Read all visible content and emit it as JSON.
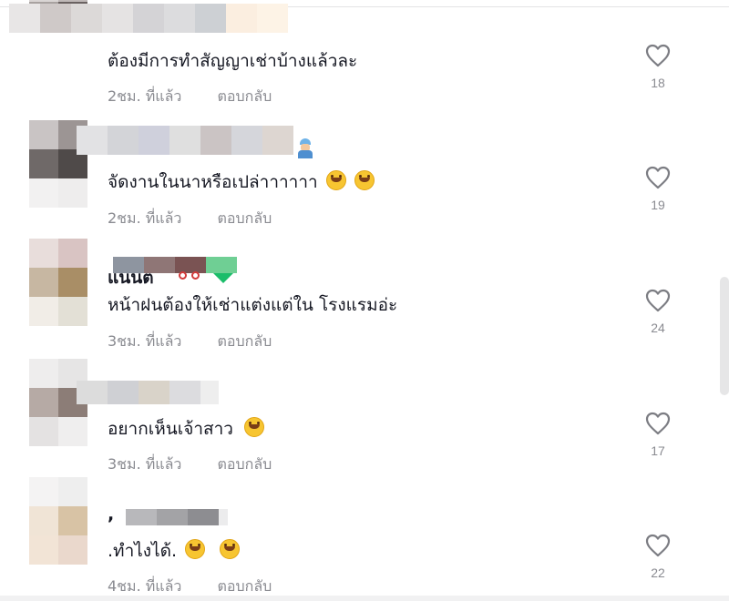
{
  "comments": [
    {
      "text": "ต้องมีการทำสัญญาเช่าบ้างแล้วละ",
      "time": "2ชม. ที่แล้ว",
      "reply": "ตอบกลับ",
      "likes": "18",
      "emojis": []
    },
    {
      "text": "จัดงานในนาหรือเปล่าาาาาา",
      "time": "2ชม. ที่แล้ว",
      "reply": "ตอบกลับ",
      "likes": "19",
      "emojis": [
        "grinning-sweat-emoji",
        "grinning-sweat-emoji"
      ]
    },
    {
      "username": "แนนต",
      "text": "หน้าฝนต้องให้เช่าแต่งแต่ใน โรงแรมอ่ะ",
      "time": "3ชม. ที่แล้ว",
      "reply": "ตอบกลับ",
      "likes": "24",
      "emojis": []
    },
    {
      "text": "อยากเห็นเจ้าสาว",
      "time": "3ชม. ที่แล้ว",
      "reply": "ตอบกลับ",
      "likes": "17",
      "emojis": [
        "tears-of-joy-emoji"
      ]
    },
    {
      "text": ".ทำไงได้.",
      "time": "4ชม. ที่แล้ว",
      "reply": "ตอบกลับ",
      "likes": "22",
      "emojis": [
        "beaming-face-emoji",
        "beaming-face-emoji"
      ]
    }
  ],
  "icons": {
    "like": "heart-outline-icon"
  },
  "colors": {
    "text": "#161823",
    "meta": "#8a8b91",
    "blur_avatar": "#c9c3c2"
  }
}
